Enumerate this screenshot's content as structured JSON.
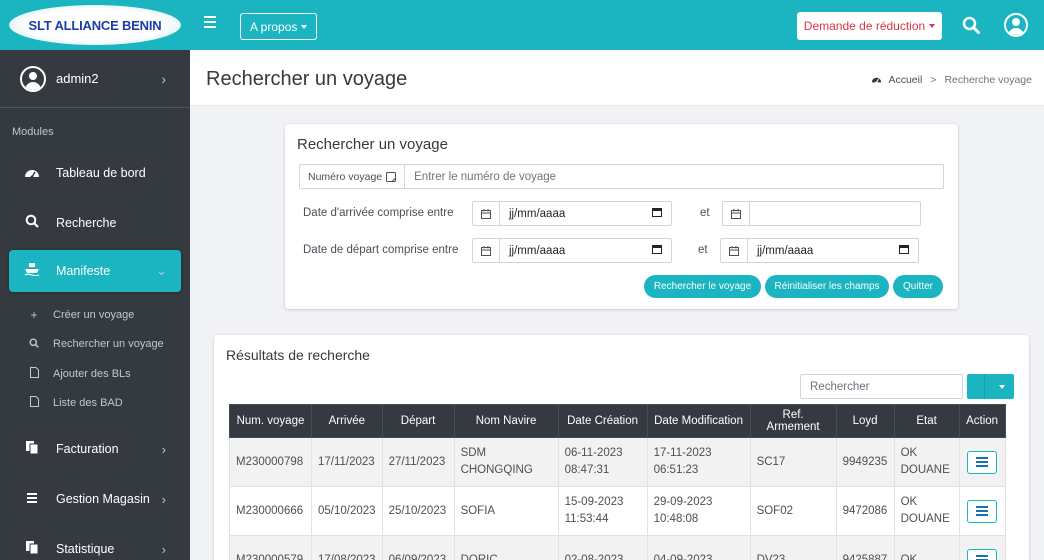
{
  "brand": {
    "name": "SLT ALLIANCE BENIN"
  },
  "user": {
    "name": "admin2"
  },
  "sidebar": {
    "modules_label": "Modules",
    "items": [
      {
        "label": "Tableau de bord",
        "icon": "dashboard-icon"
      },
      {
        "label": "Recherche",
        "icon": "search-icon"
      },
      {
        "label": "Manifeste",
        "icon": "ship-icon",
        "active": true
      },
      {
        "label": "Facturation",
        "icon": "copy-icon"
      },
      {
        "label": "Gestion Magasin",
        "icon": "list-icon"
      },
      {
        "label": "Statistique",
        "icon": "copy-icon"
      }
    ],
    "manifeste_sub": [
      {
        "label": "Créer un voyage",
        "icon": "plus-icon"
      },
      {
        "label": "Rechercher un voyage",
        "icon": "search-icon"
      },
      {
        "label": "Ajouter des BLs",
        "icon": "file-icon"
      },
      {
        "label": "Liste des BAD",
        "icon": "file-icon"
      }
    ]
  },
  "topbar": {
    "apropos_label": "A propos",
    "reduction_label": "Demande de réduction"
  },
  "header": {
    "title": "Rechercher un voyage",
    "breadcrumb": {
      "home": "Accueil",
      "separator": ">",
      "current": "Recherche voyage"
    }
  },
  "search_form": {
    "title": "Rechercher un voyage",
    "voyage_label": "Numéro voyage",
    "voyage_placeholder": "Entrer le numéro de voyage",
    "arrival_label": "Date d'arrivée comprise entre",
    "departure_label": "Date de départ comprise entre",
    "and_label": "et",
    "date_placeholder": "jj/mm/aaaa",
    "search_button": "Rechercher le voyage",
    "reset_button": "Réinitialiser les champs",
    "quit_button": "Quitter"
  },
  "results": {
    "title": "Résultats de recherche",
    "search_placeholder": "Rechercher",
    "columns": [
      "Num. voyage",
      "Arrivée",
      "Départ",
      "Nom Navire",
      "Date Création",
      "Date Modification",
      "Ref. Armement",
      "Loyd",
      "Etat",
      "Action"
    ],
    "rows": [
      [
        "M230000798",
        "17/11/2023",
        "27/11/2023",
        "SDM CHONGQING",
        "06-11-2023 08:47:31",
        "17-11-2023 06:51:23",
        "SC17",
        "9949235",
        "OK DOUANE"
      ],
      [
        "M230000666",
        "05/10/2023",
        "25/10/2023",
        "SOFIA",
        "15-09-2023 11:53:44",
        "29-09-2023 10:48:08",
        "SOF02",
        "9472086",
        "OK DOUANE"
      ],
      [
        "M230000579",
        "17/08/2023",
        "06/09/2023",
        "DORIC",
        "02-08-2023",
        "04-09-2023",
        "DV23",
        "9425887",
        "OK"
      ]
    ]
  },
  "colors": {
    "accent": "#1ab5c0",
    "sidebar": "#343a40",
    "danger": "#dc3545"
  }
}
